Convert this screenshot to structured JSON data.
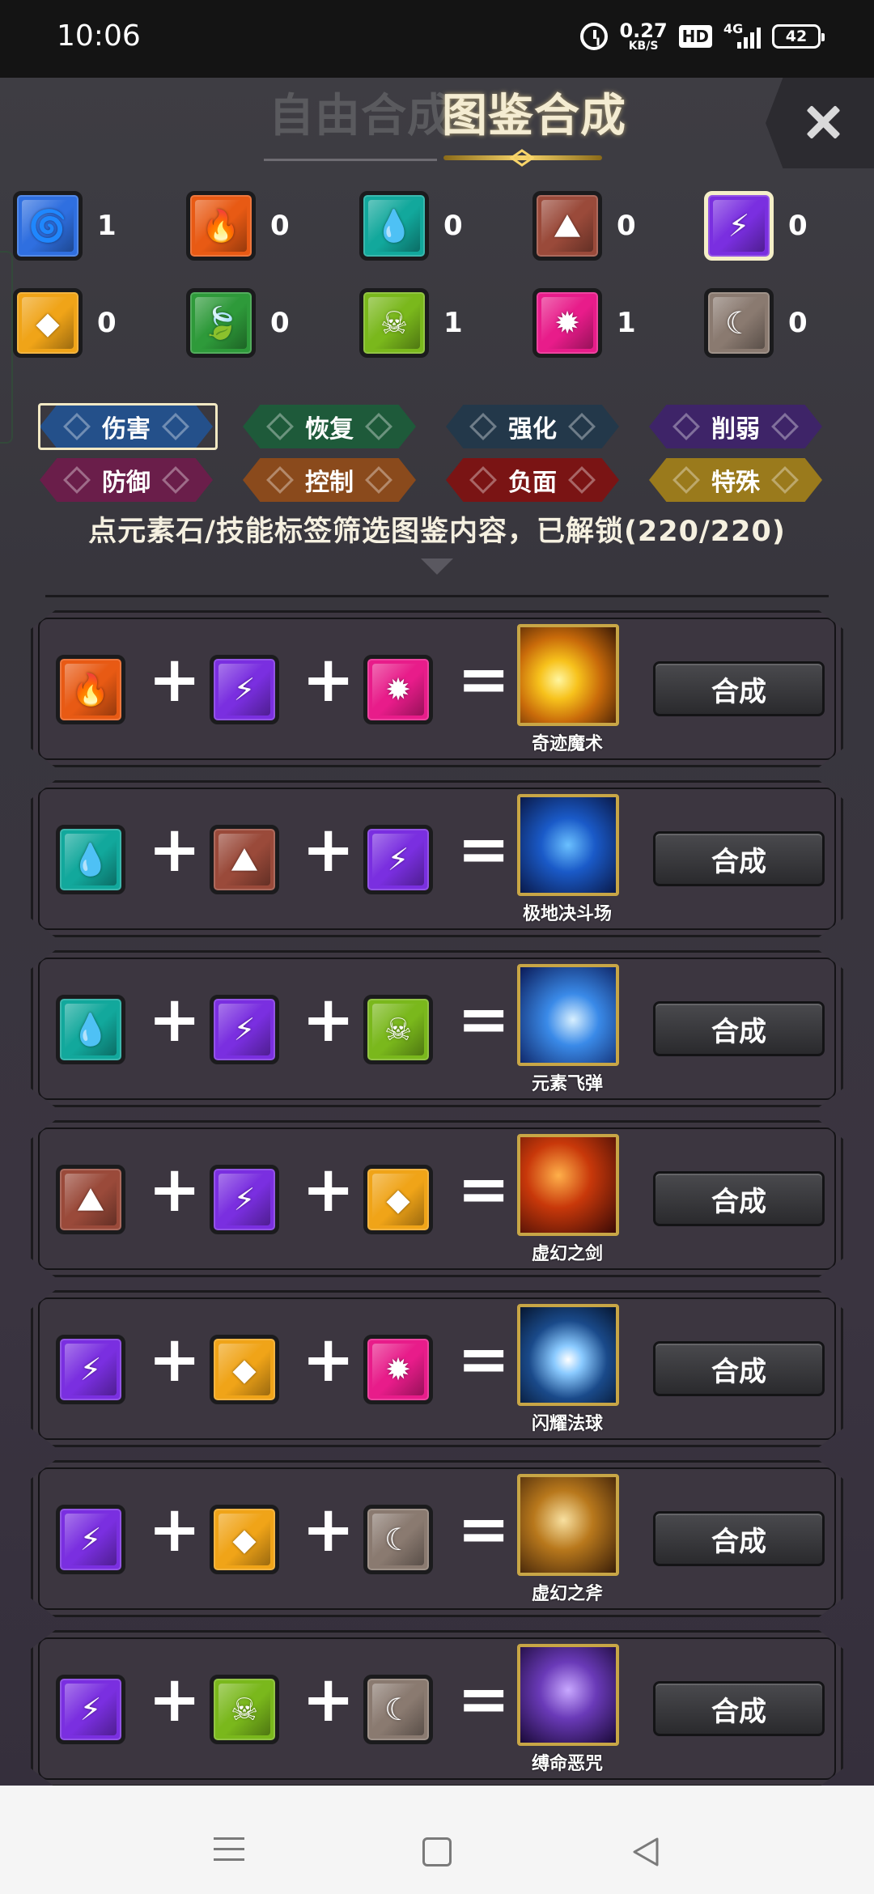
{
  "status_bar": {
    "time": "10:06",
    "speed_value": "0.27",
    "speed_unit": "KB/S",
    "hd": "HD",
    "network": "4G",
    "battery": "42"
  },
  "header": {
    "tab_free": "自由合成",
    "tab_book": "图鉴合成",
    "active_tab": "图鉴合成"
  },
  "elements": [
    {
      "name": "wind",
      "icon": "tornado-icon",
      "color": "#2f6fe0",
      "sym": "🌀",
      "count": "1"
    },
    {
      "name": "fire",
      "icon": "flame-icon",
      "color": "#e85a14",
      "sym": "🔥",
      "count": "0"
    },
    {
      "name": "water",
      "icon": "water-drop-icon",
      "color": "#12a89c",
      "sym": "💧",
      "count": "0"
    },
    {
      "name": "earth",
      "icon": "mountain-icon",
      "color": "#9a4a3a",
      "sym": "⛰",
      "count": "0"
    },
    {
      "name": "thunder",
      "icon": "lightning-icon",
      "color": "#7a2fe0",
      "sym": "⚡",
      "count": "0",
      "selected": true
    },
    {
      "name": "metal",
      "icon": "crystal-icon",
      "color": "#f0a418",
      "sym": "◆",
      "count": "0"
    },
    {
      "name": "wood",
      "icon": "leaf-icon",
      "color": "#2e9a3a",
      "sym": "🍃",
      "count": "0"
    },
    {
      "name": "poison",
      "icon": "skull-icon",
      "color": "#7ab81c",
      "sym": "☠",
      "count": "1"
    },
    {
      "name": "light",
      "icon": "sun-icon",
      "color": "#e81c8a",
      "sym": "✹",
      "count": "1"
    },
    {
      "name": "dark",
      "icon": "crescent-moon-icon",
      "color": "#8a7a70",
      "sym": "☾",
      "count": "0"
    }
  ],
  "tags": [
    {
      "label": "伤害",
      "color": "#24508a",
      "active": true
    },
    {
      "label": "恢复",
      "color": "#1e5a3a"
    },
    {
      "label": "强化",
      "color": "#23384a"
    },
    {
      "label": "削弱",
      "color": "#3e2468"
    },
    {
      "label": "防御",
      "color": "#6a1e4a"
    },
    {
      "label": "控制",
      "color": "#8a4a1c"
    },
    {
      "label": "负面",
      "color": "#7a1414"
    },
    {
      "label": "特殊",
      "color": "#9a7a1c"
    }
  ],
  "hint": "点元素石/技能标签筛选图鉴内容，已解锁(220/220)",
  "recipes": [
    {
      "inputs": [
        "fire",
        "thunder",
        "light"
      ],
      "result": "奇迹魔术",
      "result_icon": "fire-swirl-skill-icon",
      "button": "合成"
    },
    {
      "inputs": [
        "water",
        "earth",
        "thunder"
      ],
      "result": "极地决斗场",
      "result_icon": "ice-arena-skill-icon",
      "button": "合成"
    },
    {
      "inputs": [
        "water",
        "thunder",
        "poison"
      ],
      "result": "元素飞弹",
      "result_icon": "elemental-missile-skill-icon",
      "button": "合成"
    },
    {
      "inputs": [
        "earth",
        "thunder",
        "metal"
      ],
      "result": "虚幻之剑",
      "result_icon": "phantom-sword-skill-icon",
      "button": "合成"
    },
    {
      "inputs": [
        "thunder",
        "metal",
        "light"
      ],
      "result": "闪耀法球",
      "result_icon": "shining-orb-skill-icon",
      "button": "合成"
    },
    {
      "inputs": [
        "thunder",
        "metal",
        "dark"
      ],
      "result": "虚幻之斧",
      "result_icon": "phantom-axe-skill-icon",
      "button": "合成"
    },
    {
      "inputs": [
        "thunder",
        "poison",
        "dark"
      ],
      "result": "缚命恶咒",
      "result_icon": "binding-curse-skill-icon",
      "button": "合成"
    }
  ],
  "operators": {
    "plus": "+",
    "equals": "="
  }
}
